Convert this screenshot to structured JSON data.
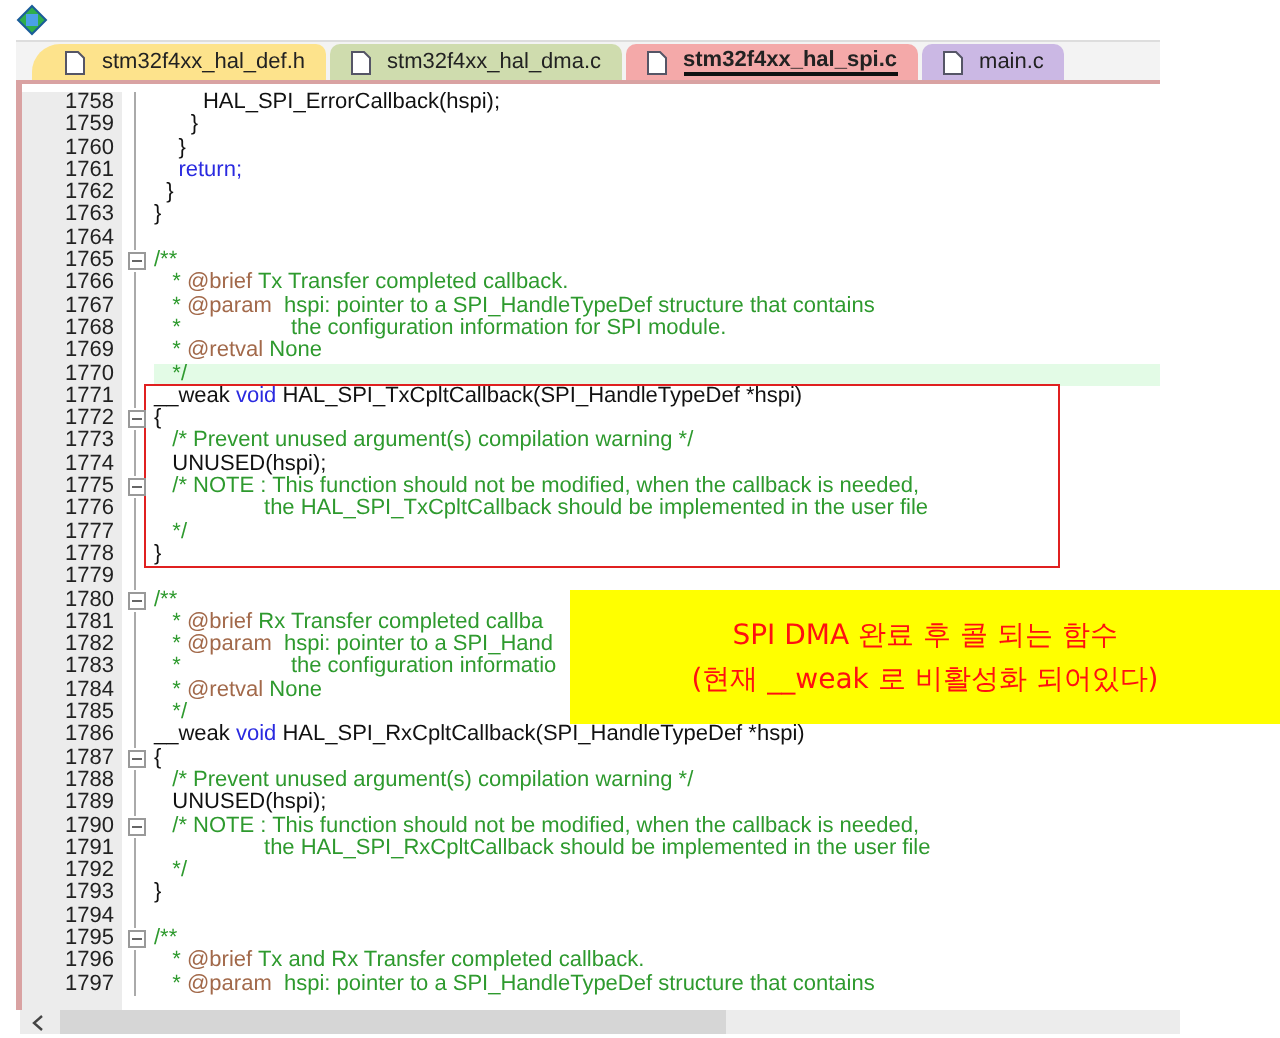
{
  "tabs": [
    {
      "label": "stm32f4xx_hal_def.h",
      "selected": false,
      "color": "#fde38c"
    },
    {
      "label": "stm32f4xx_hal_dma.c",
      "selected": false,
      "color": "#cfdcae"
    },
    {
      "label": "stm32f4xx_hal_spi.c",
      "selected": true,
      "color": "#f4a9a9"
    },
    {
      "label": "main.c",
      "selected": false,
      "color": "#cbb8e4"
    }
  ],
  "blocks": [
    {
      "boxed": false,
      "lines": [
        {
          "num": "1758",
          "collapsible": false,
          "current": false,
          "segs": [
            {
              "kind": "plain",
              "s": "        HAL_SPI_ErrorCallback(hspi);"
            }
          ]
        },
        {
          "num": "1759",
          "collapsible": false,
          "current": false,
          "segs": [
            {
              "kind": "plain",
              "s": "      }"
            }
          ]
        },
        {
          "num": "1760",
          "collapsible": false,
          "current": false,
          "segs": [
            {
              "kind": "plain",
              "s": "    }"
            }
          ]
        },
        {
          "num": "1761",
          "collapsible": false,
          "current": false,
          "segs": [
            {
              "kind": "keyword",
              "s": "    return;"
            }
          ]
        },
        {
          "num": "1762",
          "collapsible": false,
          "current": false,
          "segs": [
            {
              "kind": "plain",
              "s": "  }"
            }
          ]
        },
        {
          "num": "1763",
          "collapsible": false,
          "current": false,
          "segs": [
            {
              "kind": "plain",
              "s": "}"
            }
          ]
        },
        {
          "num": "1764",
          "collapsible": false,
          "current": false
        },
        {
          "num": "1765",
          "collapsible": true,
          "current": false,
          "segs": [
            {
              "kind": "comment",
              "s": "/**"
            }
          ]
        },
        {
          "num": "1766",
          "collapsible": false,
          "current": false,
          "segs": [
            {
              "kind": "comment",
              "s": "   * "
            },
            {
              "kind": "tag",
              "s": "@brief"
            },
            {
              "kind": "comment",
              "s": " Tx Transfer completed callback."
            }
          ]
        },
        {
          "num": "1767",
          "collapsible": false,
          "current": false,
          "segs": [
            {
              "kind": "comment",
              "s": "   * "
            },
            {
              "kind": "tag",
              "s": "@param"
            },
            {
              "kind": "comment",
              "s": "  hspi: pointer to a SPI_HandleTypeDef structure that contains"
            }
          ]
        },
        {
          "num": "1768",
          "collapsible": false,
          "current": false,
          "segs": [
            {
              "kind": "comment",
              "s": "   *                  the configuration information for SPI module."
            }
          ]
        },
        {
          "num": "1769",
          "collapsible": false,
          "current": false,
          "segs": [
            {
              "kind": "comment",
              "s": "   * "
            },
            {
              "kind": "tag",
              "s": "@retval"
            },
            {
              "kind": "comment",
              "s": " None"
            }
          ]
        },
        {
          "num": "1770",
          "collapsible": false,
          "current": true,
          "segs": [
            {
              "kind": "comment",
              "s": "   */"
            }
          ]
        }
      ]
    },
    {
      "boxed": true,
      "lines": [
        {
          "num": "1771",
          "collapsible": false,
          "current": false,
          "segs": [
            {
              "kind": "plain",
              "s": "__weak "
            },
            {
              "kind": "keyword",
              "s": "void"
            },
            {
              "kind": "plain",
              "s": " HAL_SPI_TxCpltCallback(SPI_HandleTypeDef *hspi)"
            }
          ]
        },
        {
          "num": "1772",
          "collapsible": true,
          "current": false,
          "segs": [
            {
              "kind": "plain",
              "s": "{"
            }
          ]
        },
        {
          "num": "1773",
          "collapsible": false,
          "current": false,
          "segs": [
            {
              "kind": "comment",
              "s": "   /* Prevent unused argument(s) compilation warning */"
            }
          ]
        },
        {
          "num": "1774",
          "collapsible": false,
          "current": false,
          "segs": [
            {
              "kind": "plain",
              "s": "   UNUSED(hspi);"
            }
          ]
        },
        {
          "num": "1775",
          "collapsible": true,
          "current": false,
          "segs": [
            {
              "kind": "comment",
              "s": "   /* NOTE : This function should not be modified, when the callback is needed,"
            }
          ]
        },
        {
          "num": "1776",
          "collapsible": false,
          "current": false,
          "segs": [
            {
              "kind": "comment",
              "s": "                  the HAL_SPI_TxCpltCallback should be implemented in the user file"
            }
          ]
        },
        {
          "num": "1777",
          "collapsible": false,
          "current": false,
          "segs": [
            {
              "kind": "comment",
              "s": "   */"
            }
          ]
        },
        {
          "num": "1778",
          "collapsible": false,
          "current": false,
          "segs": [
            {
              "kind": "plain",
              "s": "}"
            }
          ]
        }
      ]
    },
    {
      "boxed": false,
      "lines": [
        {
          "num": "1779",
          "collapsible": false,
          "current": false
        },
        {
          "num": "1780",
          "collapsible": true,
          "current": false,
          "segs": [
            {
              "kind": "comment",
              "s": "/**"
            }
          ]
        },
        {
          "num": "1781",
          "collapsible": false,
          "current": false,
          "segs": [
            {
              "kind": "comment",
              "s": "   * "
            },
            {
              "kind": "tag",
              "s": "@brief"
            },
            {
              "kind": "comment",
              "s": " Rx Transfer completed callba"
            }
          ]
        },
        {
          "num": "1782",
          "collapsible": false,
          "current": false,
          "segs": [
            {
              "kind": "comment",
              "s": "   * "
            },
            {
              "kind": "tag",
              "s": "@param"
            },
            {
              "kind": "comment",
              "s": "  hspi: pointer to a SPI_Hand"
            }
          ]
        },
        {
          "num": "1783",
          "collapsible": false,
          "current": false,
          "segs": [
            {
              "kind": "comment",
              "s": "   *                  the configuration informatio"
            }
          ]
        },
        {
          "num": "1784",
          "collapsible": false,
          "current": false,
          "segs": [
            {
              "kind": "comment",
              "s": "   * "
            },
            {
              "kind": "tag",
              "s": "@retval"
            },
            {
              "kind": "comment",
              "s": " None"
            }
          ]
        },
        {
          "num": "1785",
          "collapsible": false,
          "current": false,
          "segs": [
            {
              "kind": "comment",
              "s": "   */"
            }
          ]
        },
        {
          "num": "1786",
          "collapsible": false,
          "current": false,
          "segs": [
            {
              "kind": "plain",
              "s": "__weak "
            },
            {
              "kind": "keyword",
              "s": "void"
            },
            {
              "kind": "plain",
              "s": " HAL_SPI_RxCpltCallback(SPI_HandleTypeDef *hspi)"
            }
          ]
        },
        {
          "num": "1787",
          "collapsible": true,
          "current": false,
          "segs": [
            {
              "kind": "plain",
              "s": "{"
            }
          ]
        },
        {
          "num": "1788",
          "collapsible": false,
          "current": false,
          "segs": [
            {
              "kind": "comment",
              "s": "   /* Prevent unused argument(s) compilation warning */"
            }
          ]
        },
        {
          "num": "1789",
          "collapsible": false,
          "current": false,
          "segs": [
            {
              "kind": "plain",
              "s": "   UNUSED(hspi);"
            }
          ]
        },
        {
          "num": "1790",
          "collapsible": true,
          "current": false,
          "segs": [
            {
              "kind": "comment",
              "s": "   /* NOTE : This function should not be modified, when the callback is needed,"
            }
          ]
        },
        {
          "num": "1791",
          "collapsible": false,
          "current": false,
          "segs": [
            {
              "kind": "comment",
              "s": "                  the HAL_SPI_RxCpltCallback should be implemented in the user file"
            }
          ]
        },
        {
          "num": "1792",
          "collapsible": false,
          "current": false,
          "segs": [
            {
              "kind": "comment",
              "s": "   */"
            }
          ]
        },
        {
          "num": "1793",
          "collapsible": false,
          "current": false,
          "segs": [
            {
              "kind": "plain",
              "s": "}"
            }
          ]
        },
        {
          "num": "1794",
          "collapsible": false,
          "current": false
        },
        {
          "num": "1795",
          "collapsible": true,
          "current": false,
          "segs": [
            {
              "kind": "comment",
              "s": "/**"
            }
          ]
        },
        {
          "num": "1796",
          "collapsible": false,
          "current": false,
          "segs": [
            {
              "kind": "comment",
              "s": "   * "
            },
            {
              "kind": "tag",
              "s": "@brief"
            },
            {
              "kind": "comment",
              "s": " Tx and Rx Transfer completed callback."
            }
          ]
        },
        {
          "num": "1797",
          "collapsible": false,
          "current": false,
          "segs": [
            {
              "kind": "comment",
              "s": "   * "
            },
            {
              "kind": "tag",
              "s": "@param"
            },
            {
              "kind": "comment",
              "s": "  hspi: pointer to a SPI_HandleTypeDef structure that contains"
            }
          ]
        }
      ]
    }
  ],
  "callout": {
    "lines": [
      "SPI DMA 완료 후 콜 되는 함수",
      "(현재 __weak 로 비활성화 되어있다)"
    ]
  }
}
